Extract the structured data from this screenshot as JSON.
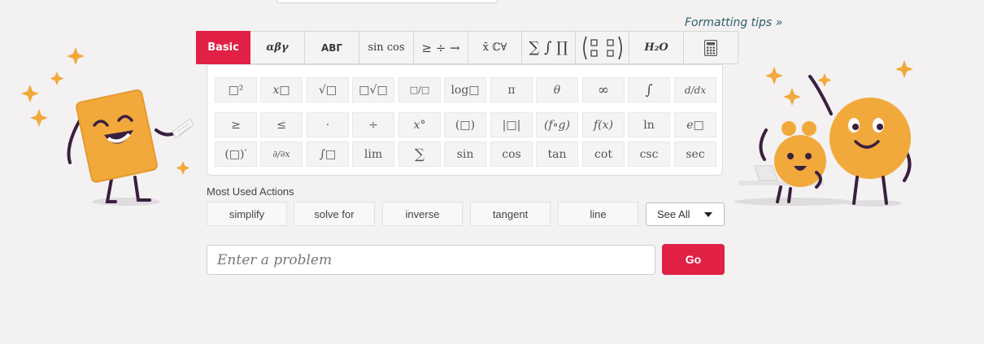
{
  "formatting_tips": "Formatting tips »",
  "tabs": [
    {
      "label": "Basic"
    },
    {
      "label": "αβγ"
    },
    {
      "label": "ΑΒΓ"
    },
    {
      "label": "sin cos"
    },
    {
      "label": "≥ ÷ →"
    },
    {
      "label": "x̄ ℂ∀"
    },
    {
      "label": "∑ ∫ ∏"
    },
    {
      "label": "(▫ ▫)"
    },
    {
      "label": "H₂O"
    },
    {
      "label": "calculator-icon"
    }
  ],
  "keys": [
    [
      "□²",
      "x□",
      "√□",
      "□√□",
      "□/□",
      "log□",
      "π",
      "θ",
      "∞",
      "∫",
      "d/dx"
    ],
    [
      "≥",
      "≤",
      "·",
      "÷",
      "x°",
      "(□)",
      "|□|",
      "(f∘g)",
      "f(x)",
      "ln",
      "e□"
    ],
    [
      "(□)′",
      "∂/∂x",
      "∫□",
      "lim",
      "∑",
      "sin",
      "cos",
      "tan",
      "cot",
      "csc",
      "sec"
    ]
  ],
  "most_used": {
    "label": "Most Used Actions",
    "actions": [
      "simplify",
      "solve for",
      "inverse",
      "tangent",
      "line"
    ],
    "see_all": "See All"
  },
  "problem_input": {
    "placeholder": "Enter a problem",
    "value": ""
  },
  "go_button": "Go",
  "colors": {
    "accent": "#e02045",
    "link": "#2d5f69",
    "character": "#f2a93b"
  }
}
